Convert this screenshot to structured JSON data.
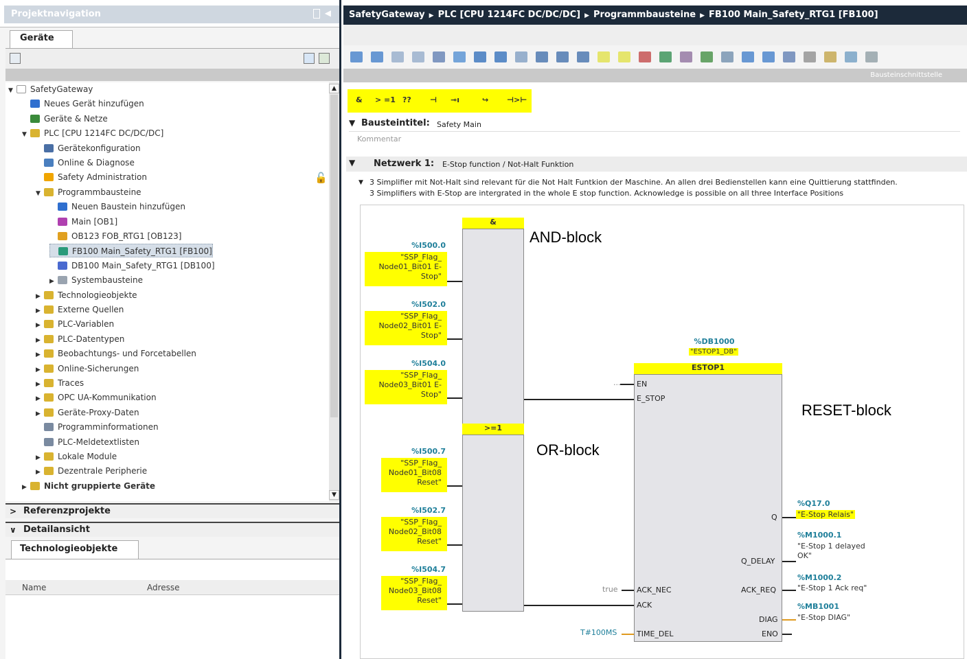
{
  "nav": {
    "title": "Projektnavigation",
    "tab": "Geräte",
    "tree": [
      {
        "label": "SafetyGateway",
        "level": 0,
        "exp": "▼",
        "color": "#ffffff"
      },
      {
        "label": "Neues Gerät hinzufügen",
        "level": 1,
        "exp": "",
        "color": "#2f6fcf"
      },
      {
        "label": "Geräte & Netze",
        "level": 1,
        "exp": "",
        "color": "#3a8a3a"
      },
      {
        "label": "PLC [CPU 1214FC DC/DC/DC]",
        "level": 1,
        "exp": "▼",
        "color": "#d9b330"
      },
      {
        "label": "Gerätekonfiguration",
        "level": 2,
        "exp": "",
        "color": "#4a6fa5"
      },
      {
        "label": "Online & Diagnose",
        "level": 2,
        "exp": "",
        "color": "#4a7fbf"
      },
      {
        "label": "Safety Administration",
        "level": 2,
        "exp": "",
        "color": "#f0a500"
      },
      {
        "label": "Programmbausteine",
        "level": 2,
        "exp": "▼",
        "color": "#d9b330"
      },
      {
        "label": "Neuen Baustein hinzufügen",
        "level": 3,
        "exp": "",
        "color": "#2f6fcf"
      },
      {
        "label": "Main [OB1]",
        "level": 3,
        "exp": "",
        "color": "#b040b0"
      },
      {
        "label": "OB123 FOB_RTG1 [OB123]",
        "level": 3,
        "exp": "",
        "color": "#e0a020"
      },
      {
        "label": "FB100 Main_Safety_RTG1 [FB100]",
        "level": 3,
        "exp": "",
        "color": "#2a9a7a",
        "sel": true
      },
      {
        "label": "DB100 Main_Safety_RTG1 [DB100]",
        "level": 3,
        "exp": "",
        "color": "#4a6ad0"
      },
      {
        "label": "Systembausteine",
        "level": 3,
        "exp": "▶",
        "color": "#9aa4b0"
      },
      {
        "label": "Technologieobjekte",
        "level": 2,
        "exp": "▶",
        "color": "#d9b330"
      },
      {
        "label": "Externe Quellen",
        "level": 2,
        "exp": "▶",
        "color": "#d9b330"
      },
      {
        "label": "PLC-Variablen",
        "level": 2,
        "exp": "▶",
        "color": "#d9b330"
      },
      {
        "label": "PLC-Datentypen",
        "level": 2,
        "exp": "▶",
        "color": "#d9b330"
      },
      {
        "label": "Beobachtungs- und Forcetabellen",
        "level": 2,
        "exp": "▶",
        "color": "#d9b330"
      },
      {
        "label": "Online-Sicherungen",
        "level": 2,
        "exp": "▶",
        "color": "#d9b330"
      },
      {
        "label": "Traces",
        "level": 2,
        "exp": "▶",
        "color": "#d9b330"
      },
      {
        "label": "OPC UA-Kommunikation",
        "level": 2,
        "exp": "▶",
        "color": "#d9b330"
      },
      {
        "label": "Geräte-Proxy-Daten",
        "level": 2,
        "exp": "▶",
        "color": "#d9b330"
      },
      {
        "label": "Programminformationen",
        "level": 2,
        "exp": "",
        "color": "#7a8aa0"
      },
      {
        "label": "PLC-Meldetextlisten",
        "level": 2,
        "exp": "",
        "color": "#7a8aa0"
      },
      {
        "label": "Lokale Module",
        "level": 2,
        "exp": "▶",
        "color": "#d9b330"
      },
      {
        "label": "Dezentrale Peripherie",
        "level": 2,
        "exp": "▶",
        "color": "#d9b330"
      },
      {
        "label": "Nicht gruppierte Geräte",
        "level": 1,
        "exp": "▶",
        "color": "#d9b330",
        "bold": true
      }
    ],
    "sections": [
      "Referenzprojekte",
      "Detailansicht"
    ],
    "detail_tab": "Technologieobjekte",
    "columns": [
      "Name",
      "Adresse"
    ]
  },
  "editor": {
    "breadcrumb": [
      "SafetyGateway",
      "PLC [CPU 1214FC DC/DC/DC]",
      "Programmbausteine",
      "FB100 Main_Safety_RTG1 [FB100]"
    ],
    "stripe_label": "Bausteinschnittstelle",
    "ladder_tools": [
      "&",
      "> =1",
      "??",
      "⊣",
      "⊸ı",
      "↪",
      "⊣>⊢"
    ],
    "block_title_label": "Bausteintitel:",
    "block_title": "Safety Main",
    "comment_placeholder": "Kommentar",
    "network_label": "Netzwerk 1:",
    "network_title": "E-Stop function / Not-Halt Funktion",
    "comment_de": "3 Simplifier mit Not-Halt sind relevant für die Not Halt Funtkion der Maschine. An allen drei Bedienstellen kann eine Quittierung stattfinden.",
    "comment_en": "3 Simplifiers with E-Stop are intergrated in the whole E stop function. Acknowledge is possible on all three Interface Positions"
  },
  "diagram": {
    "and_header": "&",
    "or_header": ">=1",
    "and_inputs": [
      {
        "addr": "%I500.0",
        "text": "\"SSP_Flag_\nNode01_Bit01 E-\nStop\""
      },
      {
        "addr": "%I502.0",
        "text": "\"SSP_Flag_\nNode02_Bit01 E-\nStop\""
      },
      {
        "addr": "%I504.0",
        "text": "\"SSP_Flag_\nNode03_Bit01 E-\nStop\""
      }
    ],
    "or_inputs": [
      {
        "addr": "%I500.7",
        "text": "\"SSP_Flag_\nNode01_Bit08\nReset\""
      },
      {
        "addr": "%I502.7",
        "text": "\"SSP_Flag_\nNode02_Bit08\nReset\""
      },
      {
        "addr": "%I504.7",
        "text": "\"SSP_Flag_\nNode03_Bit08\nReset\""
      }
    ],
    "estop_db_addr": "%DB1000",
    "estop_db_name": "\"ESTOP1_DB\"",
    "estop_name": "ESTOP1",
    "pins_left": [
      "EN",
      "E_STOP",
      "ACK_NEC",
      "ACK",
      "TIME_DEL"
    ],
    "pins_right": [
      "Q",
      "Q_DELAY",
      "ACK_REQ",
      "DIAG",
      "ENO"
    ],
    "ack_nec_value": "true",
    "time_del_value": "T#100MS",
    "en_dash": "...",
    "q_addr": "%Q17.0",
    "q_name": "\"E-Stop Relais\"",
    "qd_addr": "%M1000.1",
    "qd_name": "\"E-Stop 1 delayed\nOK\"",
    "ar_addr": "%M1000.2",
    "ar_name": "\"E-Stop 1 Ack req\"",
    "diag_addr": "%MB1001",
    "diag_name": "\"E-Stop DIAG\"",
    "ann_and": "AND-block",
    "ann_or": "OR-block",
    "ann_reset": "RESET-block"
  }
}
